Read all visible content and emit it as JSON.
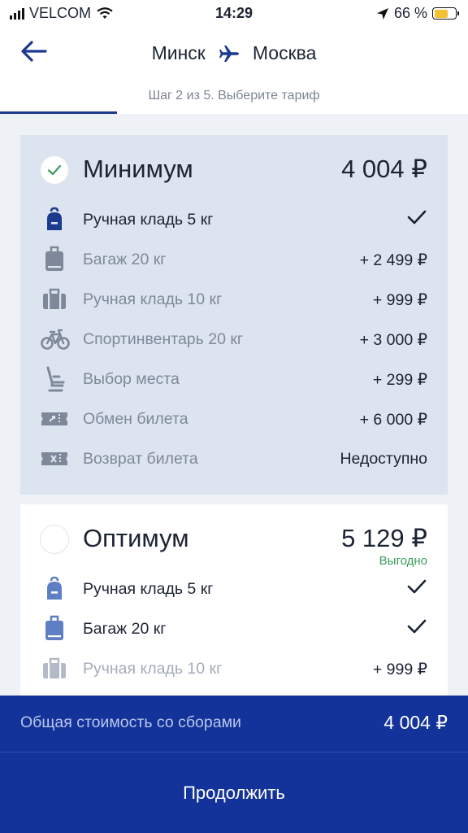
{
  "status_bar": {
    "carrier": "VELCOM",
    "time": "14:29",
    "battery": "66 %",
    "battery_level": 0.66
  },
  "header": {
    "from": "Минск",
    "to": "Москва",
    "step": "Шаг 2 из 5. Выберите тариф",
    "step_progress": 0.25
  },
  "fares": [
    {
      "title": "Минимум",
      "price": "4 004 ₽",
      "selected": true,
      "options": [
        {
          "label": "Ручная кладь 5 кг",
          "value": "✓",
          "icon": "backpack-icon",
          "included": true
        },
        {
          "label": "Багаж 20 кг",
          "value": "+ 2 499 ₽",
          "icon": "suitcase-icon",
          "included": false
        },
        {
          "label": "Ручная кладь 10 кг",
          "value": "+ 999 ₽",
          "icon": "bag-icon",
          "included": false
        },
        {
          "label": "Спортинвентарь 20 кг",
          "value": "+ 3 000 ₽",
          "icon": "bicycle-icon",
          "included": false
        },
        {
          "label": "Выбор места",
          "value": "+ 299 ₽",
          "icon": "seat-icon",
          "included": false
        },
        {
          "label": "Обмен билета",
          "value": "+ 6 000 ₽",
          "icon": "ticket-exchange-icon",
          "included": false
        },
        {
          "label": "Возврат билета",
          "value": "Недоступно",
          "icon": "ticket-refund-icon",
          "included": false
        }
      ]
    },
    {
      "title": "Оптимум",
      "price": "5 129 ₽",
      "badge": "Выгодно",
      "selected": false,
      "options": [
        {
          "label": "Ручная кладь 5 кг",
          "value": "✓",
          "icon": "backpack-icon",
          "included": true
        },
        {
          "label": "Багаж 20 кг",
          "value": "✓",
          "icon": "suitcase-icon",
          "included": true
        },
        {
          "label": "Ручная кладь 10 кг",
          "value": "+ 999 ₽",
          "icon": "bag-icon",
          "included": false
        }
      ]
    }
  ],
  "footer": {
    "total_label": "Общая стоимость со сборами",
    "total_value": "4 004 ₽",
    "continue_label": "Продолжить"
  },
  "colors": {
    "primary": "#13339a",
    "accent_green": "#3a9b5c",
    "icon_active": "#1c3a8f",
    "icon_muted": "#7f8898",
    "selected_card_bg": "#dce4f0"
  }
}
